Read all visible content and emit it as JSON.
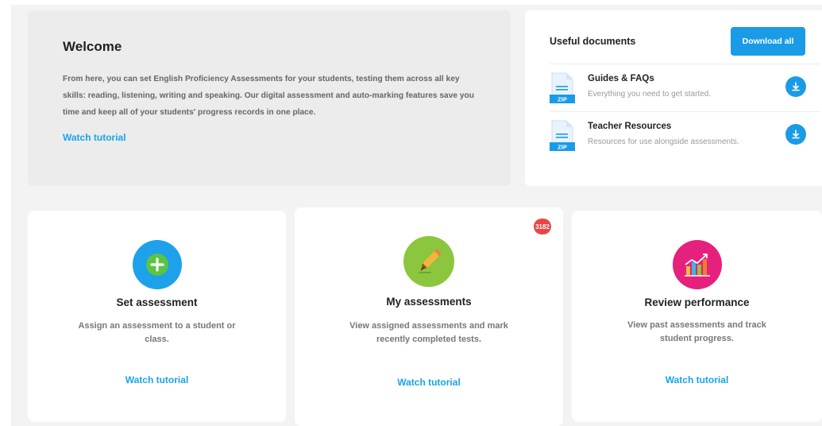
{
  "welcome": {
    "title": "Welcome",
    "text": "From here, you can set English Proficiency Assessments for your students, testing them across all key skills: reading, listening, writing and speaking. Our digital assessment and auto-marking features save you time and keep all of your students' progress records in one place.",
    "watch": "Watch tutorial"
  },
  "docs": {
    "title": "Useful documents",
    "download_all": "Download all",
    "zip_label": "ZIP",
    "items": [
      {
        "title": "Guides & FAQs",
        "subtitle": "Everything you need to get started."
      },
      {
        "title": "Teacher Resources",
        "subtitle": "Resources for use alongside assessments."
      }
    ]
  },
  "cards": [
    {
      "title": "Set assessment",
      "desc": "Assign an assessment to a student or class.",
      "watch": "Watch tutorial",
      "icon": "plus-icon",
      "color": "#1da1ea"
    },
    {
      "title": "My assessments",
      "desc": "View assigned assessments and mark recently completed tests.",
      "watch": "Watch tutorial",
      "icon": "pen-icon",
      "color": "#8cc63e",
      "badge": "3182"
    },
    {
      "title": "Review performance",
      "desc": "View past assessments and track student progress.",
      "watch": "Watch tutorial",
      "icon": "chart-icon",
      "color": "#e6207d"
    }
  ],
  "colors": {
    "accent": "#1a9be6",
    "link": "#1aa3e8",
    "badge": "#e84646"
  }
}
